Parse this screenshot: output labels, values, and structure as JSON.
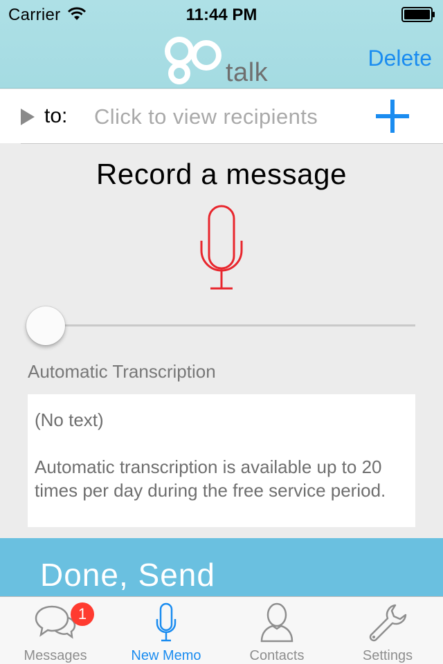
{
  "status_bar": {
    "carrier": "Carrier",
    "time": "11:44 PM",
    "wifi_icon": "wifi-icon",
    "battery_icon": "battery-icon"
  },
  "nav": {
    "logo_go": "go",
    "logo_talk": "talk",
    "delete_label": "Delete",
    "accent_color": "#1a8cf0",
    "header_color": "#a8dde4"
  },
  "recipients": {
    "expand_icon": "triangle-right-icon",
    "to_label": "to:",
    "placeholder": "Click to view recipients",
    "add_icon": "plus-icon"
  },
  "recorder": {
    "title": "Record a message",
    "mic_icon": "microphone-icon",
    "mic_color": "#e8262d",
    "progress": 0
  },
  "transcription": {
    "label": "Automatic Transcription",
    "text_line1": "(No text)",
    "text_line2": "Automatic transcription is available up to 20 times per day during the free service period."
  },
  "done": {
    "label": "Done, Send",
    "color": "#6ac0e0"
  },
  "tabs": [
    {
      "label": "Messages",
      "icon": "chat-bubbles-icon",
      "badge": "1",
      "active": false
    },
    {
      "label": "New Memo",
      "icon": "microphone-icon",
      "active": true
    },
    {
      "label": "Contacts",
      "icon": "person-icon",
      "active": false
    },
    {
      "label": "Settings",
      "icon": "wrench-icon",
      "active": false
    }
  ]
}
